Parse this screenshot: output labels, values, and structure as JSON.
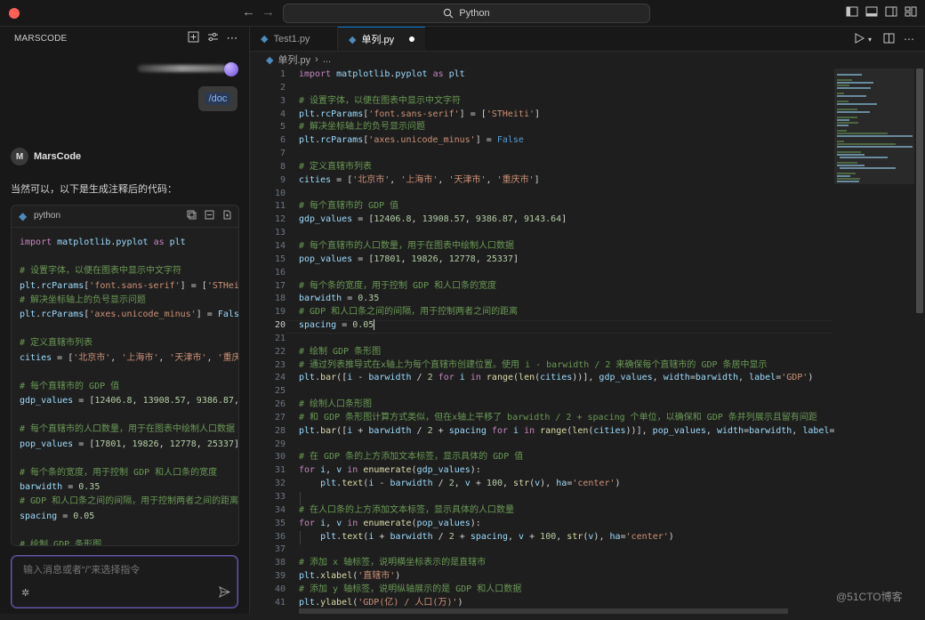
{
  "window": {
    "command_center": "Python",
    "watermark": "@51CTO博客"
  },
  "sidebar": {
    "title": "MARSCODE",
    "user_command": "/doc",
    "assistant_name": "MarsCode",
    "assistant_avatar": "M",
    "reply_text": "当然可以，以下是生成注释后的代码：",
    "code_card": {
      "language": "python",
      "lines": [
        "import matplotlib.pyplot as plt",
        "",
        "# 设置字体，以便在图表中显示中文字符",
        "plt.rcParams['font.sans-serif'] = ['STHei",
        "# 解决坐标轴上的负号显示问题",
        "plt.rcParams['axes.unicode_minus'] = Fals",
        "",
        "# 定义直辖市列表",
        "cities = ['北京市', '上海市', '天津市', '重庆",
        "",
        "# 每个直辖市的 GDP 值",
        "gdp_values = [12406.8, 13908.57, 9386.87,",
        "",
        "# 每个直辖市的人口数量，用于在图表中绘制人口数据",
        "pop_values = [17801, 19826, 12778, 25337]",
        "",
        "# 每个条的宽度，用于控制 GDP 和人口条的宽度",
        "barwidth = 0.35",
        "# GDP 和人口条之间的间隔，用于控制两者之间的距离",
        "spacing = 0.05",
        "",
        "# 绘制 GDP 条形图"
      ]
    },
    "input_placeholder": "输入消息或者“/”来选择指令"
  },
  "editor": {
    "tabs": [
      {
        "label": "Test1.py",
        "active": false
      },
      {
        "label": "单列.py",
        "active": true,
        "dirty": true
      }
    ],
    "breadcrumb": [
      "单列.py",
      "..."
    ],
    "active_line": 20,
    "line_numbers": [
      "1",
      "2",
      "3",
      "4",
      "5",
      "6",
      "7",
      "8",
      "9",
      "10",
      "11",
      "12",
      "13",
      "14",
      "15",
      "16",
      "17",
      "18",
      "19",
      "20",
      "21",
      "22",
      "23",
      "24",
      "25",
      "26",
      "27",
      "28",
      "29",
      "30",
      "31",
      "32",
      "33",
      "34",
      "35",
      "36",
      "37",
      "38",
      "39",
      "40",
      "41"
    ],
    "code_lines": [
      "import matplotlib.pyplot as plt",
      "",
      "# 设置字体，以便在图表中显示中文字符",
      "plt.rcParams['font.sans-serif'] = ['STHeiti']",
      "# 解决坐标轴上的负号显示问题",
      "plt.rcParams['axes.unicode_minus'] = False",
      "",
      "# 定义直辖市列表",
      "cities = ['北京市', '上海市', '天津市', '重庆市']",
      "",
      "# 每个直辖市的 GDP 值",
      "gdp_values = [12406.8, 13908.57, 9386.87, 9143.64]",
      "",
      "# 每个直辖市的人口数量，用于在图表中绘制人口数据",
      "pop_values = [17801, 19826, 12778, 25337]",
      "",
      "# 每个条的宽度，用于控制 GDP 和人口条的宽度",
      "barwidth = 0.35",
      "# GDP 和人口条之间的间隔，用于控制两者之间的距离",
      "spacing = 0.05",
      "",
      "# 绘制 GDP 条形图",
      "# 通过列表推导式在x轴上为每个直辖市创建位置。使用 i - barwidth / 2 来确保每个直辖市的 GDP 条居中显示",
      "plt.bar([i - barwidth / 2 for i in range(len(cities))], gdp_values, width=barwidth, label='GDP')",
      "",
      "# 绘制人口条形图",
      "# 和 GDP 条形图计算方式类似，但在x轴上平移了 barwidth / 2 + spacing 个单位，以确保和 GDP 条并列展示且留有间距",
      "plt.bar([i + barwidth / 2 + spacing for i in range(len(cities))], pop_values, width=barwidth, label='",
      "",
      "# 在 GDP 条的上方添加文本标签，显示具体的 GDP 值",
      "for i, v in enumerate(gdp_values):",
      "    plt.text(i - barwidth / 2, v + 100, str(v), ha='center')",
      "",
      "# 在人口条的上方添加文本标签，显示具体的人口数量",
      "for i, v in enumerate(pop_values):",
      "    plt.text(i + barwidth / 2 + spacing, v + 100, str(v), ha='center')",
      "",
      "# 添加 x 轴标签，说明横坐标表示的是直辖市",
      "plt.xlabel('直辖市')",
      "# 添加 y 轴标签，说明纵轴展示的是 GDP 和人口数据",
      "plt.ylabel('GDP(亿) / 人口(万)')"
    ]
  },
  "colors": {
    "accent": "#0078d4",
    "comment": "#6a9955",
    "string": "#ce9178",
    "number": "#b5cea8",
    "keyword": "#c586c0",
    "function": "#dcdcaa",
    "variable": "#9cdcfe",
    "chat_border": "#6b5aa8"
  }
}
